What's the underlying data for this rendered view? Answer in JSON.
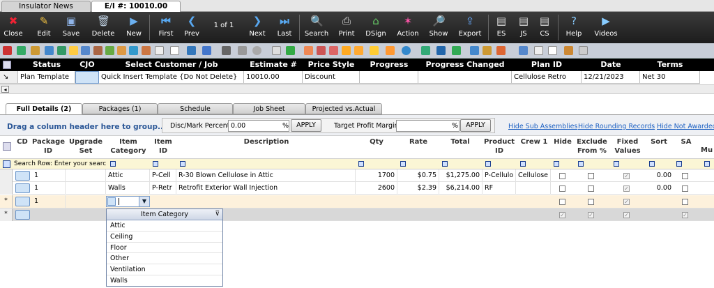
{
  "doc_tabs": [
    "Insulator News",
    "E/I #: 10010.00"
  ],
  "toolbar": {
    "close": "Close",
    "edit": "Edit",
    "save": "Save",
    "delete": "Delete",
    "new": "New",
    "first": "First",
    "prev": "Prev",
    "pager": "1 of 1",
    "next": "Next",
    "last": "Last",
    "search": "Search",
    "print": "Print",
    "dsign": "DSign",
    "action": "Action",
    "show": "Show",
    "export": "Export",
    "es": "ES",
    "js": "JS",
    "cs": "CS",
    "help": "Help",
    "videos": "Videos"
  },
  "header": {
    "columns": [
      "Status",
      "CJO",
      "Select Customer / Job",
      "Estimate #",
      "Price Style",
      "Progress",
      "Progress Changed",
      "Plan ID",
      "Date",
      "Terms"
    ],
    "row": {
      "status": "Plan Template",
      "cjo": "",
      "customer": "Quick Insert Template {Do Not Delete}",
      "estimate": "10010.00",
      "price_style": "Discount",
      "progress": "",
      "progress_changed": "",
      "plan_id": "Cellulose Retro",
      "date": "12/21/2023",
      "terms": "Net 30"
    }
  },
  "detail_tabs": [
    "Full Details (2)",
    "Packages (1)",
    "Schedule",
    "Job Sheet",
    "Projected vs.Actual"
  ],
  "group_bar": {
    "drag_hint": "Drag a column header here to group......",
    "disc_label": "Disc/Mark Percent:",
    "disc_value": "0.00",
    "pct": "%",
    "apply": "APPLY",
    "profit_label": "Target Profit Margin:",
    "profit_value": "",
    "links": [
      "Hide Sub Assemblies",
      "Hide Rounding Records",
      "Hide Not Awarded"
    ]
  },
  "grid": {
    "columns": [
      "CD",
      "Package ID",
      "Upgrade Set",
      "Item Category",
      "Item ID",
      "Description",
      "Qty",
      "Rate",
      "Total",
      "Product ID",
      "Crew 1",
      "Hide",
      "Exclude From %",
      "Fixed Values",
      "Sort",
      "SA",
      "Mu"
    ],
    "search_hint": "Search Row: Enter your search criteria here......",
    "rows": [
      {
        "package": "1",
        "category": "Attic",
        "item_id": "P-Cell",
        "description": "R-30 Blown Cellulose in Attic",
        "qty": "1700",
        "rate": "$0.75",
        "total": "$1,275.00",
        "product": "P-Cellulo",
        "crew": "Cellulose",
        "sort": "0.00"
      },
      {
        "package": "1",
        "category": "Walls",
        "item_id": "P-Retr",
        "description": "Retrofit Exterior Wall Injection",
        "qty": "2600",
        "rate": "$2.39",
        "total": "$6,214.00",
        "product": "RF",
        "crew": "",
        "sort": "0.00"
      }
    ],
    "new_row": {
      "package": "1",
      "row_marker": "*"
    }
  },
  "dropdown": {
    "title": "Item Category",
    "options": [
      "Attic",
      "Ceiling",
      "Floor",
      "Other",
      "Ventilation",
      "Walls"
    ]
  }
}
